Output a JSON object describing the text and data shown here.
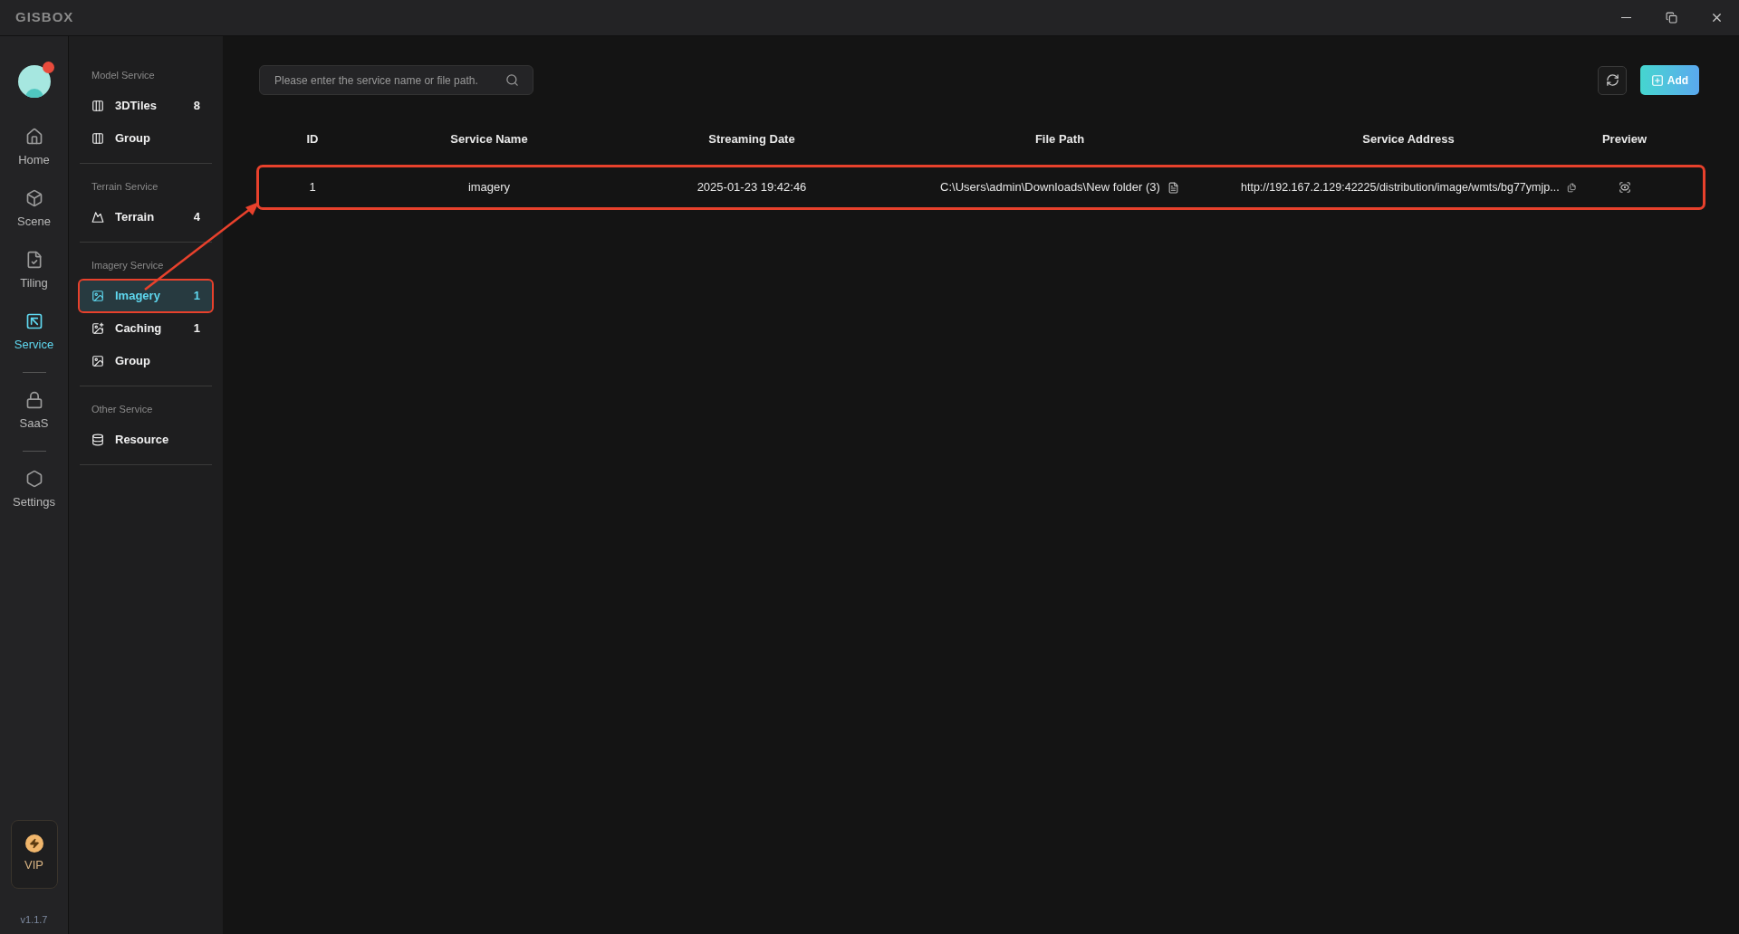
{
  "window": {
    "logo": "GISBOX"
  },
  "rail": {
    "items": [
      {
        "label": "Home",
        "kind": "home",
        "selected": false
      },
      {
        "label": "Scene",
        "kind": "scene",
        "selected": false
      },
      {
        "label": "Tiling",
        "kind": "tiling",
        "selected": false
      },
      {
        "label": "Service",
        "kind": "service",
        "selected": true
      },
      {
        "label": "SaaS",
        "kind": "saas",
        "selected": false
      },
      {
        "label": "Settings",
        "kind": "settings",
        "selected": false
      }
    ],
    "vip": "VIP",
    "version": "v1.1.7"
  },
  "sidebar": {
    "sections": [
      {
        "title": "Model Service",
        "items": [
          {
            "label": "3DTiles",
            "count": "8",
            "kind": "model",
            "selected": false,
            "highlighted": false
          },
          {
            "label": "Group",
            "kind": "model",
            "selected": false,
            "highlighted": false
          }
        ]
      },
      {
        "title": "Terrain Service",
        "items": [
          {
            "label": "Terrain",
            "count": "4",
            "kind": "terrain",
            "selected": false,
            "highlighted": false
          }
        ]
      },
      {
        "title": "Imagery Service",
        "items": [
          {
            "label": "Imagery",
            "count": "1",
            "kind": "imagery",
            "selected": true,
            "highlighted": true
          },
          {
            "label": "Caching",
            "count": "1",
            "kind": "caching",
            "selected": false,
            "highlighted": false
          },
          {
            "label": "Group",
            "kind": "imagery",
            "selected": false,
            "highlighted": false
          }
        ]
      },
      {
        "title": "Other Service",
        "items": [
          {
            "label": "Resource",
            "kind": "resource",
            "selected": false,
            "highlighted": false
          }
        ]
      }
    ]
  },
  "toolbar": {
    "search": {
      "placeholder": "Please enter the service name or file path."
    },
    "add_button": "Add"
  },
  "table": {
    "columns": [
      "ID",
      "Service Name",
      "Streaming Date",
      "File Path",
      "Service Address",
      "Preview"
    ],
    "rows": [
      {
        "id": "1",
        "service_name": "imagery",
        "streaming_date": "2025-01-23 19:42:46",
        "file_path": "C:\\Users\\admin\\Downloads\\New folder (3)",
        "service_address": "http://192.167.2.129:42225/distribution/image/wmts/bg77ymjp...",
        "highlighted": true
      }
    ]
  }
}
